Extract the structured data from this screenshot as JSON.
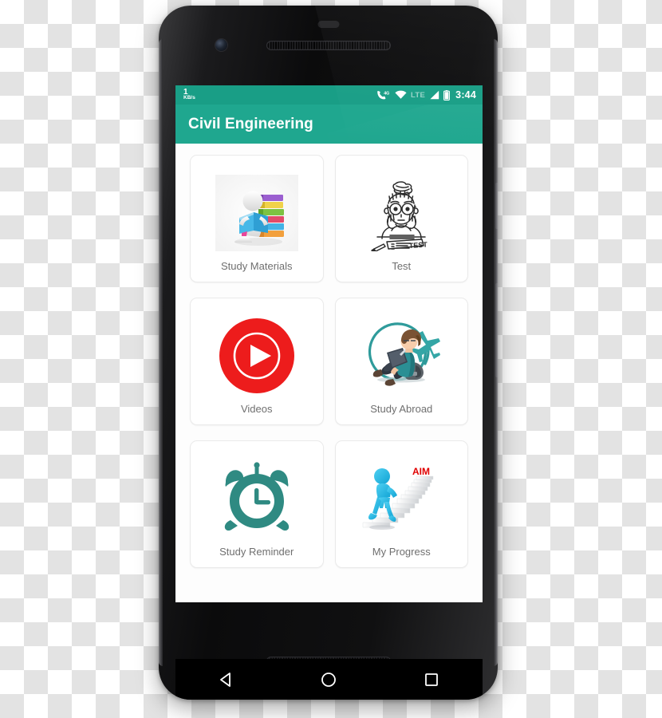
{
  "device": {
    "type": "android-smartphone",
    "hardware": {
      "front_camera": "front-camera",
      "earpiece": "earpiece-speaker",
      "sensor": "proximity-sensor",
      "bottom_speaker": "bottom-speaker-grille",
      "power_button": "power-button",
      "volume_button": "volume-rocker"
    }
  },
  "status_bar": {
    "network_speed_value": "1",
    "network_speed_unit": "KB/s",
    "icons": [
      "phone-4g-icon",
      "wifi-icon",
      "signal-bars-icon",
      "battery-icon"
    ],
    "network_type_label": "LTE",
    "clock": "3:44",
    "background_color": "#199e86",
    "foreground_color": "#ffffff"
  },
  "app_bar": {
    "title": "Civil Engineering",
    "background_color": "#1fa78f",
    "title_color": "#ffffff"
  },
  "main": {
    "background_color": "#fdfdfd",
    "label_color": "#6f6f6f",
    "cards": [
      {
        "label": "Study Materials",
        "icon": "study-materials-icon"
      },
      {
        "label": "Test",
        "icon": "test-icon"
      },
      {
        "label": "Videos",
        "icon": "videos-play-icon"
      },
      {
        "label": "Study Abroad",
        "icon": "study-abroad-icon"
      },
      {
        "label": "Study Reminder",
        "icon": "alarm-clock-icon"
      },
      {
        "label": "My Progress",
        "icon": "my-progress-icon"
      }
    ]
  },
  "nav_bar": {
    "background_color": "#000000",
    "buttons": [
      {
        "name": "back-button",
        "icon": "back-triangle-icon"
      },
      {
        "name": "home-button",
        "icon": "home-circle-icon"
      },
      {
        "name": "recents-button",
        "icon": "recents-square-icon"
      }
    ]
  },
  "colors": {
    "accent_teal": "#1fa78f",
    "status_teal": "#199e86",
    "videos_red": "#ed1c1c",
    "abroad_teal": "#2f9b9b",
    "progress_cyan": "#2ab6e4",
    "aim_red": "#e00000",
    "card_border": "#eaeaea"
  }
}
